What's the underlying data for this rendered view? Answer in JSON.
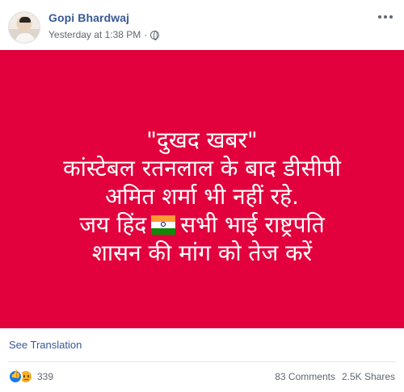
{
  "post": {
    "author": "Gopi Bhardwaj",
    "timestamp": "Yesterday at 1:38 PM",
    "separator": "·",
    "privacy_icon": "globe-icon",
    "more_icon": "more-options-icon"
  },
  "banner": {
    "background_color": "#e2003d",
    "lines": [
      "\"दुखद खबर\"",
      "कांस्टेबल रतनलाल के बाद डीसीपी",
      "अमित शर्मा भी नहीं रहे.",
      "जय हिंद",
      "सभी भाई राष्ट्रपति",
      "शासन की मांग को तेज करें"
    ],
    "flag_icon": "india-flag-icon"
  },
  "footer": {
    "see_translation": "See Translation",
    "reaction_icons": [
      "like-icon",
      "sad-icon"
    ],
    "reaction_count": "339",
    "comments": "83 Comments",
    "shares": "2.5K Shares"
  }
}
